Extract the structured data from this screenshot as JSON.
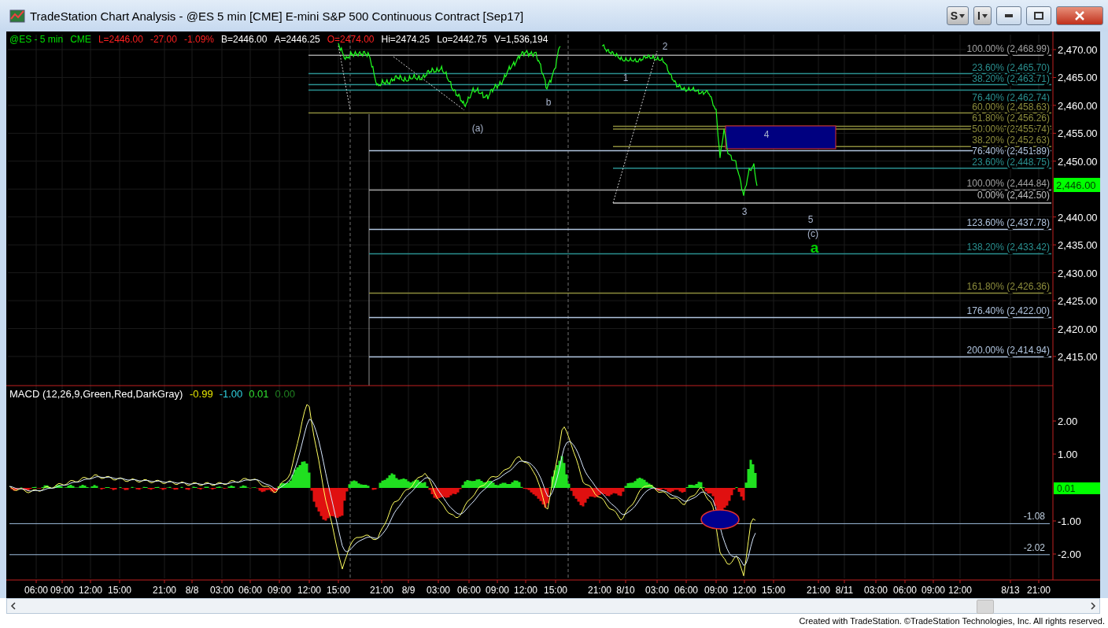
{
  "window": {
    "title": "TradeStation Chart Analysis - @ES 5 min [CME] E-mini S&P 500 Continuous Contract [Sep17]",
    "buttons": [
      {
        "kind": "style",
        "label": "S"
      },
      {
        "kind": "indicator",
        "label": "I"
      },
      {
        "kind": "minimize"
      },
      {
        "kind": "maximize"
      },
      {
        "kind": "close"
      }
    ]
  },
  "price_panel": {
    "quote": [
      {
        "text": "@ES - 5 min",
        "color": "#00e000"
      },
      {
        "text": "CME",
        "color": "#00e000"
      },
      {
        "text": "L=2446.00",
        "color": "#ff2020"
      },
      {
        "text": "-27.00",
        "color": "#ff2020"
      },
      {
        "text": "-1.09%",
        "color": "#ff2020"
      },
      {
        "text": "B=2446.00",
        "color": "#ffffff"
      },
      {
        "text": "A=2446.25",
        "color": "#ffffff"
      },
      {
        "text": "O=2474.00",
        "color": "#ff2020"
      },
      {
        "text": "Hi=2474.25",
        "color": "#ffffff"
      },
      {
        "text": "Lo=2442.75",
        "color": "#ffffff"
      },
      {
        "text": "V=1,536,194",
        "color": "#ffffff"
      }
    ],
    "axis_labels": [
      "2,470.00",
      "2,465.00",
      "2,460.00",
      "2,455.00",
      "2,450.00",
      "2,440.00",
      "2,435.00",
      "2,430.00",
      "2,425.00",
      "2,420.00",
      "2,415.00"
    ],
    "last_price": "2,446.00",
    "fib_levels": [
      {
        "label": "100.00% (2,468.99)",
        "color": "#a0a0a0"
      },
      {
        "label": "23.60% (2,465.70)",
        "color": "#2a9090"
      },
      {
        "label": "38.20% (2,463.71)",
        "color": "#2a9090"
      },
      {
        "label": "76.40% (2,462.74)",
        "color": "#2a9090"
      },
      {
        "label": "60.00% (2,458.63)",
        "color": "#8c8c3c"
      },
      {
        "label": "61.80% (2,456.26)",
        "color": "#8c8c3c"
      },
      {
        "label": "50.00% (2,455.74)",
        "color": "#8c8c3c"
      },
      {
        "label": "38.20% (2,452.63)",
        "color": "#8c8c3c"
      },
      {
        "label": "76.40% (2,451.89)",
        "color": "#b0c4de"
      },
      {
        "label": "23.60% (2,448.75)",
        "color": "#2a9090"
      },
      {
        "label": "100.00% (2,444.84)",
        "color": "#a0a0a0"
      },
      {
        "label": "0.00% (2,442.50)",
        "color": "#c0c0c0"
      },
      {
        "label": "123.60% (2,437.78)",
        "color": "#b0c4de"
      },
      {
        "label": "138.20% (2,433.42)",
        "color": "#2a9090"
      },
      {
        "label": "161.80% (2,426.36)",
        "color": "#8c8c3c"
      },
      {
        "label": "176.40% (2,422.00)",
        "color": "#b0c4de"
      },
      {
        "label": "200.00% (2,414.94)",
        "color": "#b0c4de"
      }
    ],
    "wave_labels": [
      {
        "text": "(a)",
        "kind": "minor"
      },
      {
        "text": "b",
        "kind": "minor"
      },
      {
        "text": "1",
        "kind": "minor"
      },
      {
        "text": "2",
        "kind": "minor"
      },
      {
        "text": "4",
        "kind": "minor"
      },
      {
        "text": "3",
        "kind": "minor"
      },
      {
        "text": "5",
        "kind": "minor"
      },
      {
        "text": "(c)",
        "kind": "minor"
      },
      {
        "text": "a",
        "kind": "major"
      }
    ]
  },
  "macd_panel": {
    "legend": "MACD (12,26,9,Green,Red,DarkGray)",
    "values": [
      {
        "text": "-0.99",
        "color": "#e6e600"
      },
      {
        "text": "-1.00",
        "color": "#30d0e0"
      },
      {
        "text": "0.01",
        "color": "#30e030"
      },
      {
        "text": "0.00",
        "color": "#208020"
      }
    ],
    "axis_labels": [
      "2.00",
      "1.00",
      "-1.00",
      "-2.00"
    ],
    "last_value": "0.01",
    "levels": [
      "-1.08",
      "-2.02"
    ]
  },
  "time_axis": {
    "labels": [
      "06:00",
      "09:00",
      "12:00",
      "15:00",
      "21:00",
      "8/8",
      "03:00",
      "06:00",
      "09:00",
      "12:00",
      "15:00",
      "21:00",
      "8/9",
      "03:00",
      "06:00",
      "09:00",
      "12:00",
      "15:00",
      "21:00",
      "8/10",
      "03:00",
      "06:00",
      "09:00",
      "12:00",
      "15:00",
      "21:00",
      "8/11",
      "03:00",
      "06:00",
      "09:00",
      "12:00",
      "8/13",
      "21:00"
    ]
  },
  "footer": "Created with TradeStation. ©TradeStation Technologies, Inc. All rights reserved."
}
